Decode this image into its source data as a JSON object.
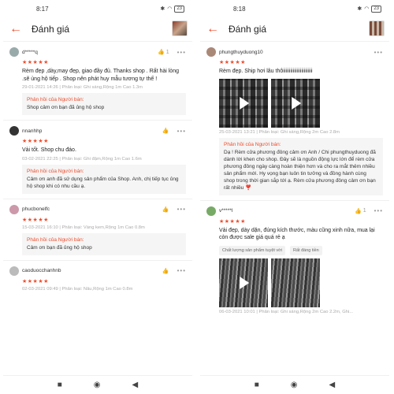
{
  "left": {
    "status": {
      "time": "8:17",
      "battery": "23"
    },
    "header": {
      "title": "Đánh giá"
    },
    "reviews": [
      {
        "user": "d*****q",
        "likes": "1",
        "text": "Rèm đẹp ,dày,may đẹp, giao đầy đủ. Thanks shop . Rất hài lòng .sẽ ủng hộ tiếp . Shop nên phát huy mẫu tương tự thế !",
        "meta": "29-01-2021 14:26 | Phân loại: Ghi sáng,Rộng 1m Cao 1.3m",
        "reply_label": "Phản hồi của Người bán:",
        "reply": "Shop cảm ơn bạn đã ủng hộ shop"
      },
      {
        "user": "nnanhhp",
        "likes": "",
        "text": "Vải tốt. Shop chu đáo.",
        "meta": "03-02-2021 22:25 | Phân loại: Ghi đậm,Rộng 1m Cao 1.6m",
        "reply_label": "Phản hồi của Người bán:",
        "reply": "Cảm ơn anh đã sử dụng sản phẩm của Shop. Anh, chị tiếp tục ủng hộ shop khi có nhu cầu ạ."
      },
      {
        "user": "phucbonelfc",
        "likes": "",
        "text": "",
        "meta": "15-03-2021 16:10 | Phân loại: Vàng kem,Rộng 1m Cao 0.8m",
        "reply_label": "Phản hồi của Người bán:",
        "reply": "Cảm ơn bạn đã ủng hộ shop"
      },
      {
        "user": "caoduocchanhnb",
        "likes": "",
        "text": "",
        "meta": "02-03-2021 09:49 | Phân loại: Nâu,Rộng 1m Cao 0.8m"
      }
    ]
  },
  "right": {
    "status": {
      "time": "8:18",
      "battery": "23"
    },
    "header": {
      "title": "Đánh giá"
    },
    "reviews": [
      {
        "user": "phungthuyduong10",
        "text": "Rèm đẹp. Ship hơi lâu thôiiiiiiiiiiiiiiiiiiiiiiii",
        "meta": "25-03-2021 13:21 | Phân loại: Ghi sáng,Rộng 2m Cao 2.8m",
        "reply_label": "Phản hồi của Người bán:",
        "reply": "Dạ ! Rèm cửa phương đông cảm ơn Anh / Chi phungthuyduong đã dành lời khen cho shop. Đây sẽ là nguồn động lực lớn để rèm cửa phương đông ngày càng hoàn thiện hơn và cho ra mắt thêm nhiều sản phẩm mới. Hy vọng bạn luôn tin tưởng và đồng hành cùng shop trong thời gian sắp tới ạ. Rèm cửa phương đông cảm ơn bạn rất nhiều ❣️"
      },
      {
        "user": "v*****l",
        "likes": "1",
        "text": "Vải đẹp, dày dặn, đúng kích thước, màu cũng xinh nữa, mua lại còn được sale giá quá rẻ ạ",
        "tags": [
          "Chất lượng sản phẩm tuyệt vời",
          "Rất đáng tiền"
        ],
        "meta": "06-03-2021 10:01 | Phân loại: Ghi sáng,Rộng 2m Cao 2.2m, Ghi..."
      }
    ]
  },
  "icons": {
    "stars": "★★★★★",
    "back": "←",
    "like": "👍",
    "more": "•••"
  },
  "nav": {
    "square": "■",
    "circle": "◉",
    "back": "◀"
  }
}
